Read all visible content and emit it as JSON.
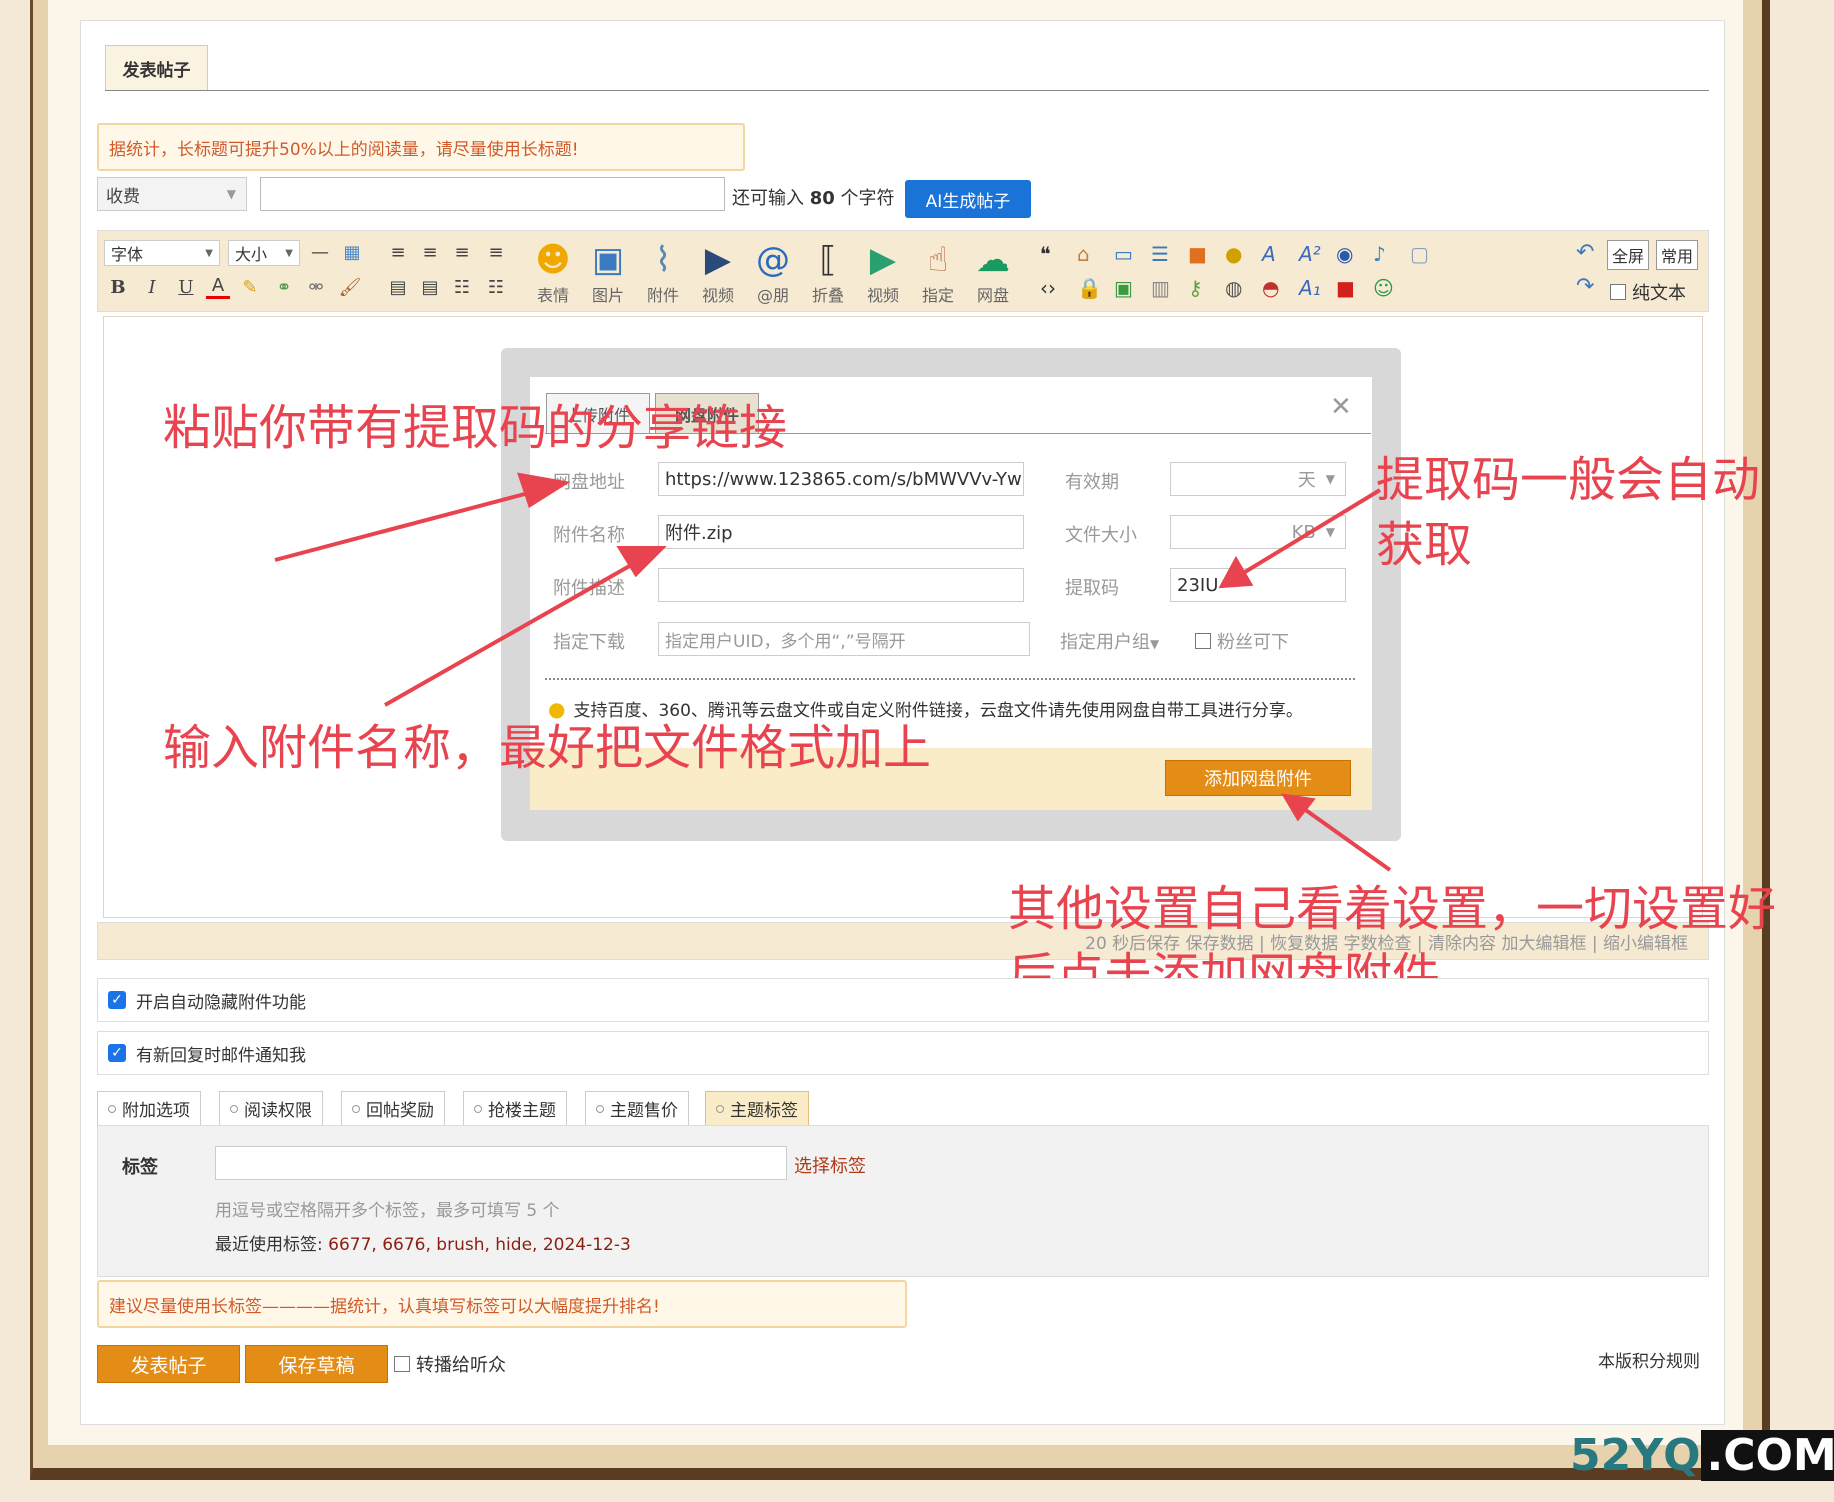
{
  "tab": {
    "post_label": "发表帖子"
  },
  "notice_top": "据统计，长标题可提升50%以上的阅读量，请尽量使用长标题!",
  "title_row": {
    "fee_select": "收费",
    "remain_prefix": "还可输入",
    "remain_count": "80",
    "remain_suffix": "个字符",
    "ai_button": "AI生成帖子"
  },
  "toolbar": {
    "font_select": "字体",
    "size_select": "大小",
    "big_icons": [
      {
        "label": "表情",
        "icon": "emoji-icon"
      },
      {
        "label": "图片",
        "icon": "image-icon"
      },
      {
        "label": "附件",
        "icon": "attachment-icon"
      },
      {
        "label": "视频",
        "icon": "video-icon"
      },
      {
        "label": "@朋",
        "icon": "at-icon"
      },
      {
        "label": "折叠",
        "icon": "fold-icon"
      },
      {
        "label": "视频",
        "icon": "video2-icon"
      },
      {
        "label": "指定",
        "icon": "hand-icon"
      },
      {
        "label": "网盘",
        "icon": "cloud-disk-icon"
      }
    ],
    "fullscreen": "全屏",
    "common": "常用",
    "plain_text": "纯文本"
  },
  "editor_footer": "20 秒后保存 保存数据 | 恢复数据   字数检查 | 清除内容   加大编辑框 | 缩小编辑框",
  "dialog": {
    "tab_upload": "上传附件",
    "tab_netdisk": "网盘附件",
    "label_url": "网盘地址",
    "value_url": "https://www.123865.com/s/bMWVVv-Yw",
    "label_name": "附件名称",
    "value_name": "附件.zip",
    "label_desc": "附件描述",
    "value_desc": "",
    "label_download": "指定下载",
    "placeholder_download": "指定用户UID，多个用“,”号隔开",
    "label_valid": "有效期",
    "valid_unit": "天",
    "label_size": "文件大小",
    "size_unit": "KB",
    "label_code": "提取码",
    "value_code": "23IU",
    "label_group": "指定用户组",
    "fans_only": "粉丝可下",
    "tip": "支持百度、360、腾讯等云盘文件或自定义附件链接，云盘文件请先使用网盘自带工具进行分享。",
    "add_button": "添加网盘附件"
  },
  "annotations": {
    "paste": "粘贴你带有提取码的分享链接",
    "code_auto_1": "提取码一般会自动",
    "code_auto_2": "获取",
    "name_tip": "输入附件名称，最好把文件格式加上",
    "other_1": "其他设置自己看着设置，一切设置好",
    "other_2": "后点击添加网盘附件"
  },
  "options": {
    "auto_hide": "开启自动隐藏附件功能",
    "email_notify": "有新回复时邮件通知我",
    "tabs": [
      "附加选项",
      "阅读权限",
      "回帖奖励",
      "抢楼主题",
      "主题售价",
      "主题标签"
    ]
  },
  "tags": {
    "label": "标签",
    "pick": "选择标签",
    "hint": "用逗号或空格隔开多个标签，最多可填写 5 个",
    "recent_prefix": "最近使用标签:",
    "recent": "6677, 6676, brush, hide, 2024-12-3"
  },
  "notice_bottom": "建议尽量使用长标签————据统计，认真填写标签可以大幅度提升排名!",
  "buttons": {
    "submit": "发表帖子",
    "draft": "保存草稿",
    "forward": "转播给听众",
    "rules": "本版积分规则"
  },
  "watermark": {
    "a": "52YQ",
    "b": ".COM"
  },
  "colors": {
    "accent_orange": "#e38c16",
    "ai_blue": "#1a73d6",
    "annotation_red": "#e8444f"
  }
}
